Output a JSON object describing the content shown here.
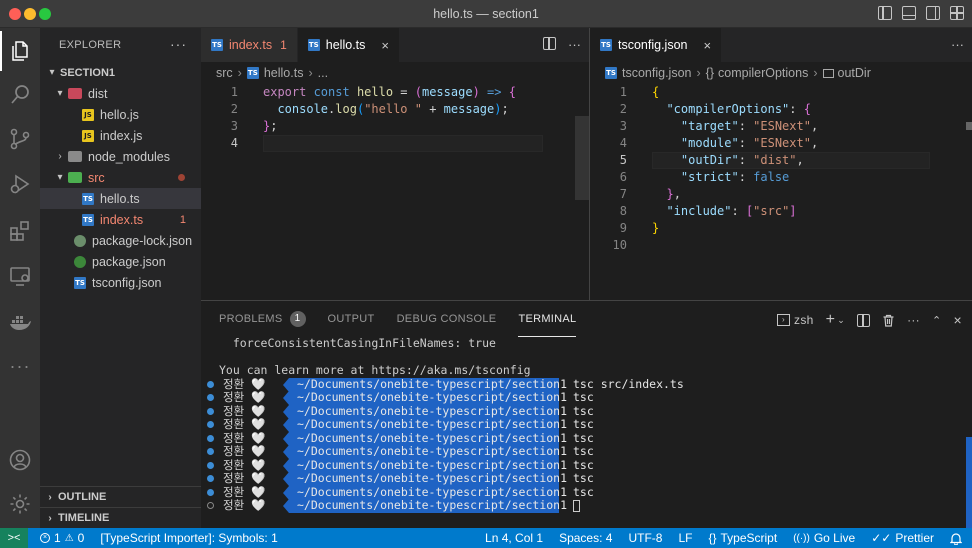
{
  "window": {
    "title": "hello.ts — section1"
  },
  "activity_bar": {
    "items": [
      {
        "name": "explorer-icon"
      },
      {
        "name": "search-icon"
      },
      {
        "name": "source-control-icon"
      },
      {
        "name": "run-debug-icon"
      },
      {
        "name": "extensions-icon"
      },
      {
        "name": "remote-explorer-icon"
      },
      {
        "name": "docker-icon"
      },
      {
        "name": "more-icon"
      }
    ],
    "bottom": [
      {
        "name": "account-icon"
      },
      {
        "name": "settings-gear-icon"
      }
    ]
  },
  "sidebar": {
    "header": "EXPLORER",
    "more": "···",
    "root": "SECTION1",
    "tree": [
      {
        "label": "dist",
        "type": "folder",
        "depth": 1,
        "expanded": true
      },
      {
        "label": "hello.js",
        "type": "js",
        "depth": 2
      },
      {
        "label": "index.js",
        "type": "js",
        "depth": 2
      },
      {
        "label": "node_modules",
        "type": "folder-grey",
        "depth": 1,
        "expanded": false
      },
      {
        "label": "src",
        "type": "folder-green",
        "depth": 1,
        "expanded": true,
        "error": true
      },
      {
        "label": "hello.ts",
        "type": "ts",
        "depth": 2,
        "selected": true
      },
      {
        "label": "index.ts",
        "type": "ts",
        "depth": 2,
        "error": true,
        "count": "1"
      },
      {
        "label": "package-lock.json",
        "type": "json",
        "depth": 1
      },
      {
        "label": "package.json",
        "type": "json-pkg",
        "depth": 1
      },
      {
        "label": "tsconfig.json",
        "type": "tsconfig",
        "depth": 1
      }
    ],
    "outline": "OUTLINE",
    "timeline": "TIMELINE"
  },
  "editor_left": {
    "tabs": [
      {
        "label": "index.ts",
        "badge": "1",
        "active": false,
        "error": true
      },
      {
        "label": "hello.ts",
        "close": "×",
        "active": true
      }
    ],
    "breadcrumb": {
      "folder": "src",
      "file": "hello.ts",
      "tail": "..."
    },
    "lines": [
      {
        "n": "1",
        "tokens": [
          {
            "t": "export ",
            "c": "kw2"
          },
          {
            "t": "const ",
            "c": "kw"
          },
          {
            "t": "hello",
            "c": "fn"
          },
          {
            "t": " = ",
            "c": "plain"
          },
          {
            "t": "(",
            "c": "br2"
          },
          {
            "t": "message",
            "c": "var"
          },
          {
            "t": ")",
            "c": "br2"
          },
          {
            "t": " => ",
            "c": "kw"
          },
          {
            "t": "{",
            "c": "br2"
          }
        ]
      },
      {
        "n": "2",
        "tokens": [
          {
            "t": "  console",
            "c": "var"
          },
          {
            "t": ".",
            "c": "plain"
          },
          {
            "t": "log",
            "c": "fn"
          },
          {
            "t": "(",
            "c": "br3"
          },
          {
            "t": "\"hello \"",
            "c": "str"
          },
          {
            "t": " + ",
            "c": "plain"
          },
          {
            "t": "message",
            "c": "var"
          },
          {
            "t": ")",
            "c": "br3"
          },
          {
            "t": ";",
            "c": "plain"
          }
        ]
      },
      {
        "n": "3",
        "tokens": [
          {
            "t": "}",
            "c": "br2"
          },
          {
            "t": ";",
            "c": "plain"
          }
        ]
      },
      {
        "n": "4",
        "tokens": [],
        "current": true
      }
    ]
  },
  "editor_right": {
    "tabs": [
      {
        "label": "tsconfig.json",
        "close": "×",
        "active": true
      }
    ],
    "breadcrumb": {
      "file": "tsconfig.json",
      "obj": "compilerOptions",
      "prop": "outDir",
      "obj_icon": "{}"
    },
    "lines": [
      {
        "n": "1",
        "tokens": [
          {
            "t": "{",
            "c": "br1"
          }
        ]
      },
      {
        "n": "2",
        "tokens": [
          {
            "t": "  \"compilerOptions\"",
            "c": "var"
          },
          {
            "t": ": ",
            "c": "plain"
          },
          {
            "t": "{",
            "c": "br2"
          }
        ]
      },
      {
        "n": "3",
        "tokens": [
          {
            "t": "    \"target\"",
            "c": "var"
          },
          {
            "t": ": ",
            "c": "plain"
          },
          {
            "t": "\"ESNext\"",
            "c": "str"
          },
          {
            "t": ",",
            "c": "plain"
          }
        ]
      },
      {
        "n": "4",
        "tokens": [
          {
            "t": "    \"module\"",
            "c": "var"
          },
          {
            "t": ": ",
            "c": "plain"
          },
          {
            "t": "\"ESNext\"",
            "c": "str"
          },
          {
            "t": ",",
            "c": "plain"
          }
        ]
      },
      {
        "n": "5",
        "tokens": [
          {
            "t": "    \"outDir\"",
            "c": "var"
          },
          {
            "t": ": ",
            "c": "plain"
          },
          {
            "t": "\"dist\"",
            "c": "str"
          },
          {
            "t": ",",
            "c": "plain"
          }
        ],
        "current": true
      },
      {
        "n": "6",
        "tokens": [
          {
            "t": "    \"strict\"",
            "c": "var"
          },
          {
            "t": ": ",
            "c": "plain"
          },
          {
            "t": "false",
            "c": "kw"
          }
        ]
      },
      {
        "n": "7",
        "tokens": [
          {
            "t": "  }",
            "c": "br2"
          },
          {
            "t": ",",
            "c": "plain"
          }
        ]
      },
      {
        "n": "8",
        "tokens": [
          {
            "t": "  \"include\"",
            "c": "var"
          },
          {
            "t": ": ",
            "c": "plain"
          },
          {
            "t": "[",
            "c": "br2"
          },
          {
            "t": "\"src\"",
            "c": "str"
          },
          {
            "t": "]",
            "c": "br2"
          }
        ]
      },
      {
        "n": "9",
        "tokens": [
          {
            "t": "}",
            "c": "br1"
          }
        ]
      },
      {
        "n": "10",
        "tokens": []
      }
    ]
  },
  "panel": {
    "tabs": [
      {
        "label": "PROBLEMS",
        "badge": "1"
      },
      {
        "label": "OUTPUT"
      },
      {
        "label": "DEBUG CONSOLE"
      },
      {
        "label": "TERMINAL",
        "active": true
      }
    ],
    "shell": "zsh",
    "terminal": {
      "pre_lines": [
        "  forceConsistentCasingInFileNames: true",
        "",
        "You can learn more at https://aka.ms/tsconfig"
      ],
      "user": "정환 🤍",
      "path": "~/Documents/onebite-typescript/section1",
      "commands": [
        "tsc src/index.ts",
        "tsc",
        "tsc",
        "tsc",
        "tsc",
        "tsc",
        "tsc",
        "tsc",
        "tsc",
        ""
      ]
    }
  },
  "status": {
    "remote": "><",
    "errors": "1",
    "warnings": "0",
    "symbols": "[TypeScript Importer]: Symbols: 1",
    "position": "Ln 4, Col 1",
    "spaces": "Spaces: 4",
    "encoding": "UTF-8",
    "eol": "LF",
    "language": "TypeScript",
    "lang_icon": "{}",
    "golive": "Go Live",
    "prettier": "Prettier"
  }
}
